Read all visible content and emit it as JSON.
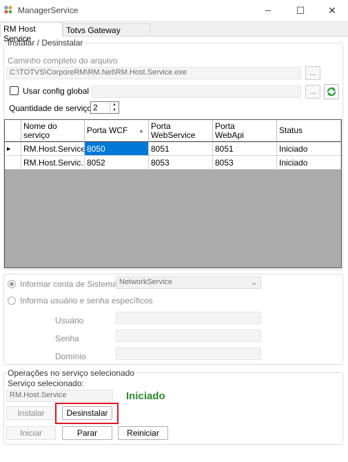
{
  "window": {
    "title": "ManagerService",
    "minimize_symbol": "─",
    "maximize_symbol": "☐",
    "close_symbol": "✕"
  },
  "tabs": [
    {
      "label": "RM Host Service",
      "active": true
    },
    {
      "label": "Totvs Gateway Manager",
      "active": false
    }
  ],
  "install": {
    "legend": "Instalar / Desinstalar",
    "path_label": "Caminho completo do arquivo",
    "path_value": "C:\\TOTVS\\CorporeRM\\RM.Net\\RM.Host.Service.exe",
    "browse_label": "...",
    "use_global_label": "Usar config global",
    "use_global_checked": false,
    "global_value": "",
    "global_browse_label": "...",
    "quantity_label": "Quantidade de serviços",
    "quantity_value": "2",
    "spin_up": "▲",
    "spin_down": "▼"
  },
  "grid": {
    "columns": [
      "Nome do serviço",
      "Porta WCF",
      "Porta WebService",
      "Porta WebApi",
      "Status"
    ],
    "sort_indicator": "▲",
    "row_pointer": "▶",
    "rows": [
      {
        "name": "RM.Host.Service",
        "wcf": "8050",
        "ws": "8051",
        "api": "8051",
        "status": "Iniciado"
      },
      {
        "name": "RM.Host.Servic...",
        "wcf": "8052",
        "ws": "8053",
        "api": "8053",
        "status": "Iniciado"
      }
    ]
  },
  "account": {
    "system_account_label": "Informar conta de Sistema",
    "system_account_value": "NetworkService",
    "combo_arrow": "⌄",
    "specific_user_label": "Informa usuário e senha específicos",
    "user_label": "Usuário",
    "password_label": "Senha",
    "domain_label": "Domínio"
  },
  "operations": {
    "legend": "Operações no serviço selecionado",
    "selected_label": "Serviço selecionado:",
    "selected_value": "RM.Host.Service",
    "status_text": "Iniciado",
    "install_label": "Instalar",
    "uninstall_label": "Desinstalar",
    "start_label": "Iniciar",
    "stop_label": "Parar",
    "restart_label": "Reiniciar"
  },
  "colors": {
    "status_green": "#2a8a2a",
    "selection_blue": "#0078d7",
    "highlight_red": "#e0141e",
    "refresh_green": "#2f9e3f"
  }
}
